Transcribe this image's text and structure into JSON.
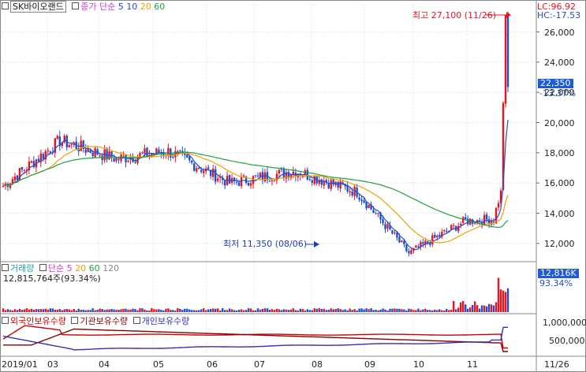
{
  "stock": {
    "name": "SK바이오랜드",
    "legend": {
      "close_label": "종가",
      "ma_label": "단순",
      "ma": [
        {
          "label": "5",
          "color": "#1f4fd0"
        },
        {
          "label": "10",
          "color": "#1f4fd0"
        },
        {
          "label": "20",
          "color": "#f0a000"
        },
        {
          "label": "60",
          "color": "#20a040"
        }
      ]
    },
    "lc": "LC:96.92",
    "hc": "HC:-17.53",
    "high_annotation": "최고 27,100 (11/26)",
    "low_annotation": "최저 11,350 (08/06)",
    "current_price": "22,350",
    "current_change": "-13.37%"
  },
  "volume": {
    "label": "거래량",
    "ma_label": "단순",
    "ma": [
      {
        "label": "5",
        "color": "#f0a000"
      },
      {
        "label": "20",
        "color": "#f0a000"
      },
      {
        "label": "60",
        "color": "#20a040"
      },
      {
        "label": "120",
        "color": "#888888"
      }
    ],
    "value_text": "12,815,764주(93.34%)",
    "current_badge": "12,816K",
    "current_pct": "93.34%"
  },
  "holdings": {
    "legend": [
      {
        "label": "외국인보유수량",
        "color": "#cc0000"
      },
      {
        "label": "기관보유수량",
        "color": "#880000"
      },
      {
        "label": "개인보유수량",
        "color": "#3030b0"
      }
    ],
    "y_ticks": [
      "1,000,000",
      "500,000"
    ]
  },
  "price_axis": {
    "ticks": [
      "26,000",
      "24,000",
      "22,000",
      "20,000",
      "18,000",
      "16,000",
      "14,000",
      "12,000"
    ]
  },
  "x_axis": {
    "ticks": [
      "2019/01",
      "03",
      "04",
      "05",
      "06",
      "07",
      "08",
      "09",
      "10",
      "11",
      "11/26"
    ]
  },
  "colors": {
    "up": "#e8141e",
    "down": "#1f4fd0",
    "ma5": "#1f4fd0",
    "ma20": "#f0a000",
    "ma60": "#20a040",
    "magenta": "#d040d0",
    "badge_blue": "#1f5bd6",
    "grid": "#d8d8d8"
  },
  "chart_data": {
    "type": "candlestick",
    "price_key_points": [
      {
        "date": "2019-01",
        "value": 15800
      },
      {
        "date": "2019-02",
        "value": 18800
      },
      {
        "date": "2019-03",
        "value": 17600
      },
      {
        "date": "2019-04",
        "value": 18100
      },
      {
        "date": "2019-05",
        "value": 16000
      },
      {
        "date": "2019-06",
        "value": 16800
      },
      {
        "date": "2019-07",
        "value": 15400
      },
      {
        "date": "2019-08",
        "value": 11350
      },
      {
        "date": "2019-09",
        "value": 13500
      },
      {
        "date": "2019-10",
        "value": 13600
      },
      {
        "date": "2019-11",
        "value": 15500
      },
      {
        "date": "2019-11-26",
        "value": 27100
      },
      {
        "date": "2019-11-27",
        "value": 22350
      }
    ],
    "high": {
      "value": 27100,
      "date": "11/26"
    },
    "low": {
      "value": 11350,
      "date": "08/06"
    },
    "last_close": 22350,
    "last_change_pct": -13.37,
    "last_volume": 12815764,
    "price_ylim": [
      11000,
      27800
    ]
  }
}
